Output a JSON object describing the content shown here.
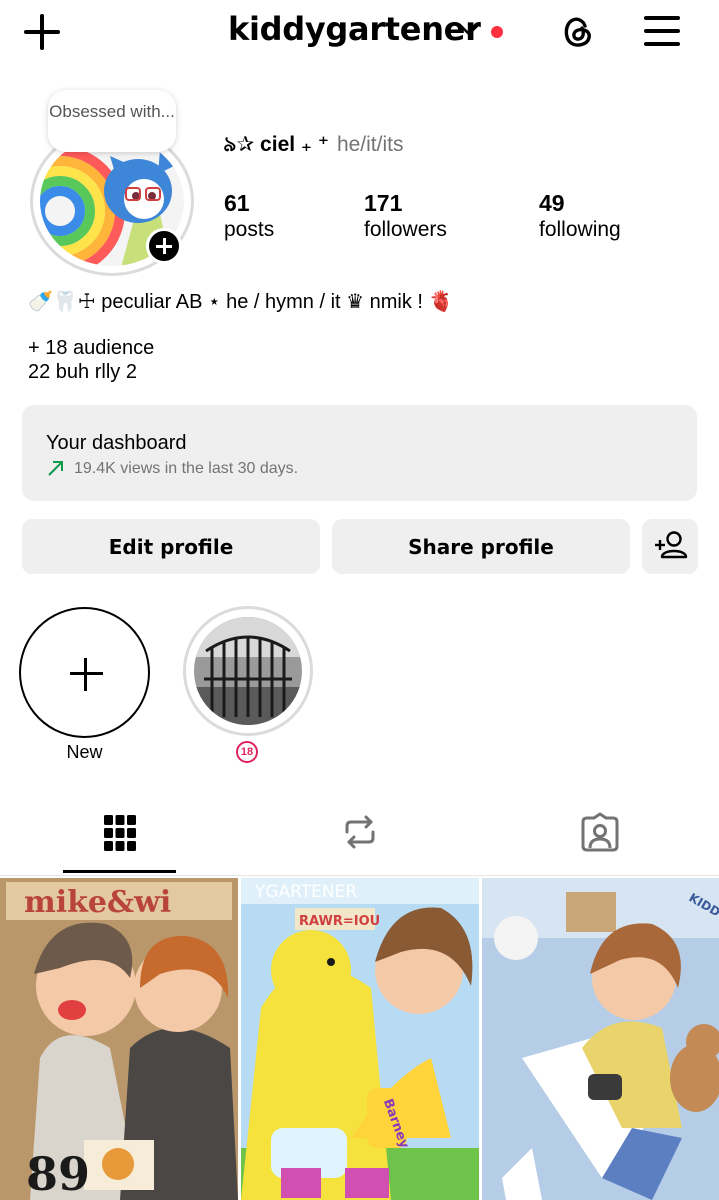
{
  "header": {
    "username": "kiddygartener",
    "icons": [
      "plus-icon",
      "chevron-down-icon",
      "threads-icon",
      "menu-icon"
    ],
    "notification_color": "#ff3040"
  },
  "profile": {
    "note": "Obsessed with...",
    "display_name": "৯✰ ciel ₊ ⁺",
    "pronouns": "he/it/its",
    "stats": [
      {
        "value": "61",
        "label": "posts"
      },
      {
        "value": "171",
        "label": "followers"
      },
      {
        "value": "49",
        "label": "following"
      }
    ],
    "bio_lines": [
      "🍼🦷☩ peculiar AB ⋆ he / hymn / it ♛ nmik ! 🫀",
      "+ 18 audience",
      "22 buh rlly 2"
    ]
  },
  "dashboard": {
    "title": "Your dashboard",
    "subtitle": "19.4K views in the last 30 days.",
    "trend_color": "#0d9a4c"
  },
  "buttons": {
    "edit": "Edit profile",
    "share": "Share profile"
  },
  "highlights": {
    "new_label": "New",
    "badge": "18"
  },
  "tabs": [
    "grid-icon",
    "reposts-icon",
    "tagged-icon"
  ],
  "posts": [
    {
      "caption_text": "mike&wi",
      "corner_text": "89"
    },
    {
      "caption_text": "YGARTENER",
      "sub_text": "RAWR=IOU",
      "sleeve_text": "Barney"
    },
    {
      "caption_text": "KIDDYG"
    }
  ]
}
